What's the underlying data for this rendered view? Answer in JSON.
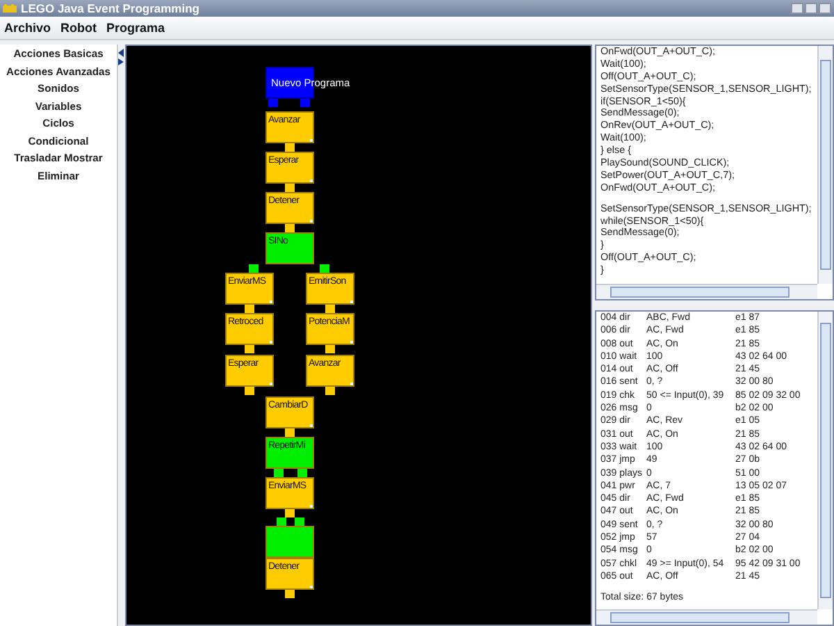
{
  "window": {
    "title": "LEGO Java Event Programming"
  },
  "menu": [
    "Archivo",
    "Robot",
    "Programa"
  ],
  "palette": [
    "Acciones Basicas",
    "Acciones Avanzadas",
    "Sonidos",
    "Variables",
    "Ciclos",
    "Condicional",
    "Trasladar Mostrar",
    "Eliminar"
  ],
  "blocks": [
    {
      "kind": "start",
      "label": "Nuevo Programa"
    },
    {
      "kind": "action",
      "label": "Avanzar"
    },
    {
      "kind": "action",
      "label": "Esperar"
    },
    {
      "kind": "action",
      "label": "Detener"
    },
    {
      "kind": "condition",
      "label": "SINo"
    },
    {
      "kind": "action",
      "label": "EnviarMS"
    },
    {
      "kind": "action",
      "label": "EmitirSon"
    },
    {
      "kind": "action",
      "label": "Retroced"
    },
    {
      "kind": "action",
      "label": "PotenciaM"
    },
    {
      "kind": "action",
      "label": "Esperar"
    },
    {
      "kind": "action",
      "label": "Avanzar"
    },
    {
      "kind": "action",
      "label": "CambiarD"
    },
    {
      "kind": "loop",
      "label": "RepetirMi"
    },
    {
      "kind": "action",
      "label": "EnviarMS"
    },
    {
      "kind": "loop-end"
    },
    {
      "kind": "action",
      "label": "Detener"
    }
  ],
  "code": [
    [
      "OnFwd(OUT_A+OUT_C);",
      "Wait(100);",
      "Off(OUT_A+OUT_C);",
      "SetSensorType(SENSOR_1,SENSOR_LIGHT);",
      "if(SENSOR_1<50){",
      "SendMessage(0);",
      "OnRev(OUT_A+OUT_C);",
      "Wait(100);",
      "} else {",
      "PlaySound(SOUND_CLICK);",
      "SetPower(OUT_A+OUT_C,7);",
      "OnFwd(OUT_A+OUT_C);"
    ],
    [
      "SetSensorType(SENSOR_1,SENSOR_LIGHT);",
      "while(SENSOR_1<50){",
      "SendMessage(0);",
      "}",
      "Off(OUT_A+OUT_C);",
      "}"
    ]
  ],
  "bytecode": [
    [
      "004 dir",
      "ABC, Fwd",
      "e1 87"
    ],
    [
      "006 dir",
      "AC, Fwd",
      "e1 85"
    ],
    [
      "008 out",
      "AC, On",
      "21 85"
    ],
    [
      "010 wait",
      "100",
      "43 02 64 00"
    ],
    [
      "014 out",
      "AC, Off",
      "21 45"
    ],
    [
      "016 sent",
      "0, ?",
      "32 00 80"
    ],
    [
      "019 chk",
      "50 <= Input(0), 39",
      "85 02 09 32 00"
    ],
    [
      "026 msg",
      "0",
      "b2 02 00"
    ],
    [
      "029 dir",
      "AC, Rev",
      "e1 05"
    ],
    [
      "031 out",
      "AC, On",
      "21 85"
    ],
    [
      "033 wait",
      "100",
      "43 02 64 00"
    ],
    [
      "037 jmp",
      "49",
      "27 0b"
    ],
    [
      "039 plays",
      "0",
      "51 00"
    ],
    [
      "041 pwr",
      "AC, 7",
      "13 05 02 07"
    ],
    [
      "045 dir",
      "AC, Fwd",
      "e1 85"
    ],
    [
      "047 out",
      "AC, On",
      "21 85"
    ],
    [
      "049 sent",
      "0, ?",
      "32 00 80"
    ],
    [
      "052 jmp",
      "57",
      "27 04"
    ],
    [
      "054 msg",
      "0",
      "b2 02 00"
    ],
    [
      "057 chkl",
      "49 >= Input(0), 54",
      "95 42 09 31 00"
    ],
    [
      "065 out",
      "AC, Off",
      "21 45"
    ]
  ],
  "total": "Total size: 67 bytes"
}
